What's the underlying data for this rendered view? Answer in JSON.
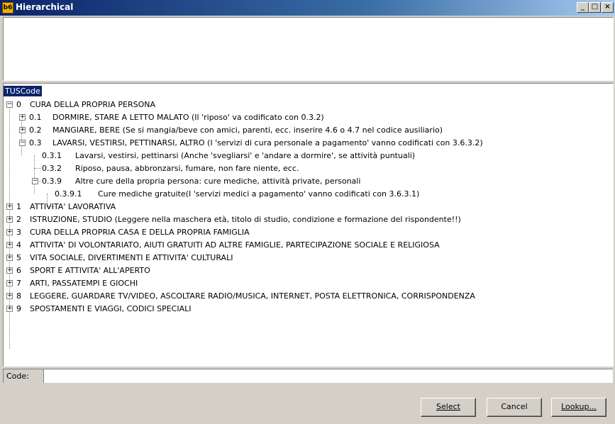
{
  "window": {
    "title": "Hierarchical",
    "icon_text": "b6",
    "controls": {
      "minimize": "_",
      "maximize": "□",
      "close": "×"
    }
  },
  "tree": {
    "root_label": "TUSCode",
    "nodes": [
      {
        "code": "0",
        "text": "CURA DELLA PROPRIA PERSONA",
        "expander": "−"
      },
      {
        "code": "0.1",
        "text": "DORMIRE, STARE A LETTO MALATO (Il 'riposo' va codificato con 0.3.2)",
        "expander": "+"
      },
      {
        "code": "0.2",
        "text": "MANGIARE, BERE (Se si mangia/beve con amici, parenti, ecc. inserire 4.6 o 4.7 nel codice ausiliario)",
        "expander": "+"
      },
      {
        "code": "0.3",
        "text": "LAVARSI, VESTIRSI, PETTINARSI, ALTRO (I 'servizi di cura personale a pagamento' vanno codificati con 3.6.3.2)",
        "expander": "−"
      },
      {
        "code": "0.3.1",
        "text": "Lavarsi, vestirsi, pettinarsi (Anche 'svegliarsi' e 'andare a dormire', se attività puntuali)",
        "expander": ""
      },
      {
        "code": "0.3.2",
        "text": "Riposo, pausa, abbronzarsi, fumare, non fare niente, ecc.",
        "expander": ""
      },
      {
        "code": "0.3.9",
        "text": "Altre cure della propria persona: cure mediche, attività private, personali",
        "expander": "−"
      },
      {
        "code": "0.3.9.1",
        "text": "Cure mediche gratuite(I 'servizi medici a pagamento' vanno codificati con 3.6.3.1)",
        "expander": ""
      },
      {
        "code": "1",
        "text": "ATTIVITA' LAVORATIVA",
        "expander": "+"
      },
      {
        "code": "2",
        "text": "ISTRUZIONE, STUDIO (Leggere nella maschera età, titolo di studio, condizione e formazione del rispondente!!)",
        "expander": "+"
      },
      {
        "code": "3",
        "text": "CURA DELLA PROPRIA CASA E DELLA PROPRIA FAMIGLIA",
        "expander": "+"
      },
      {
        "code": "4",
        "text": "ATTIVITA' DI VOLONTARIATO, AIUTI GRATUITI AD ALTRE FAMIGLIE, PARTECIPAZIONE SOCIALE E RELIGIOSA",
        "expander": "+"
      },
      {
        "code": "5",
        "text": "VITA SOCIALE, DIVERTIMENTI E ATTIVITA' CULTURALI",
        "expander": "+"
      },
      {
        "code": "6",
        "text": "SPORT E ATTIVITA' ALL'APERTO",
        "expander": "+"
      },
      {
        "code": "7",
        "text": "ARTI, PASSATEMPI E GIOCHI",
        "expander": "+"
      },
      {
        "code": "8",
        "text": "LEGGERE, GUARDARE TV/VIDEO, ASCOLTARE RADIO/MUSICA, INTERNET, POSTA ELETTRONICA, CORRISPONDENZA",
        "expander": "+"
      },
      {
        "code": "9",
        "text": "SPOSTAMENTI E VIAGGI, CODICI SPECIALI",
        "expander": "+"
      }
    ]
  },
  "code_field": {
    "label": "Code:",
    "value": ""
  },
  "buttons": {
    "select": "Select",
    "cancel": "Cancel",
    "lookup": "Lookup..."
  }
}
